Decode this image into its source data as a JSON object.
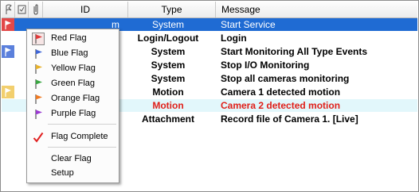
{
  "columns": {
    "flag": "flag-icon",
    "check": "checkbox-icon",
    "attach": "paperclip-icon",
    "id": "ID",
    "type": "Type",
    "message": "Message"
  },
  "rows": [
    {
      "id_fragment": "m",
      "type": "System",
      "message": "Start Service",
      "flag_color": "#e03c3c"
    },
    {
      "type": "Login/Logout",
      "message": "Login"
    },
    {
      "type": "System",
      "message": "Start Monitoring All Type Events",
      "flag_color": "#4a74d8"
    },
    {
      "type": "System",
      "message": "Stop I/O Monitoring"
    },
    {
      "type": "System",
      "message": "Stop all cameras monitoring"
    },
    {
      "type": "Motion",
      "message": "Camera 1 detected motion",
      "flag_color": "#e6b43c"
    },
    {
      "type": "Motion",
      "message": "Camera 2 detected motion"
    },
    {
      "type": "Attachment",
      "message": "Record file of Camera 1. [Live]"
    }
  ],
  "menu": {
    "items": [
      {
        "label": "Red Flag",
        "color": "#e03a3a",
        "icon": "red-flag-icon"
      },
      {
        "label": "Blue Flag",
        "color": "#3f66d6",
        "icon": "blue-flag-icon"
      },
      {
        "label": "Yellow Flag",
        "color": "#e8b22a",
        "icon": "yellow-flag-icon"
      },
      {
        "label": "Green Flag",
        "color": "#3aa642",
        "icon": "green-flag-icon"
      },
      {
        "label": "Orange Flag",
        "color": "#f07a22",
        "icon": "orange-flag-icon"
      },
      {
        "label": "Purple Flag",
        "color": "#9a3ad2",
        "icon": "purple-flag-icon"
      },
      {
        "label": "Flag Complete",
        "color": "#e02020",
        "icon": "checkmark-icon"
      },
      {
        "label": "Clear Flag"
      },
      {
        "label": "Setup"
      }
    ]
  },
  "colors": {
    "selected_row": "#1f6bd3",
    "highlight_row": "#e2f7fb",
    "alert_text": "#e0201a"
  }
}
